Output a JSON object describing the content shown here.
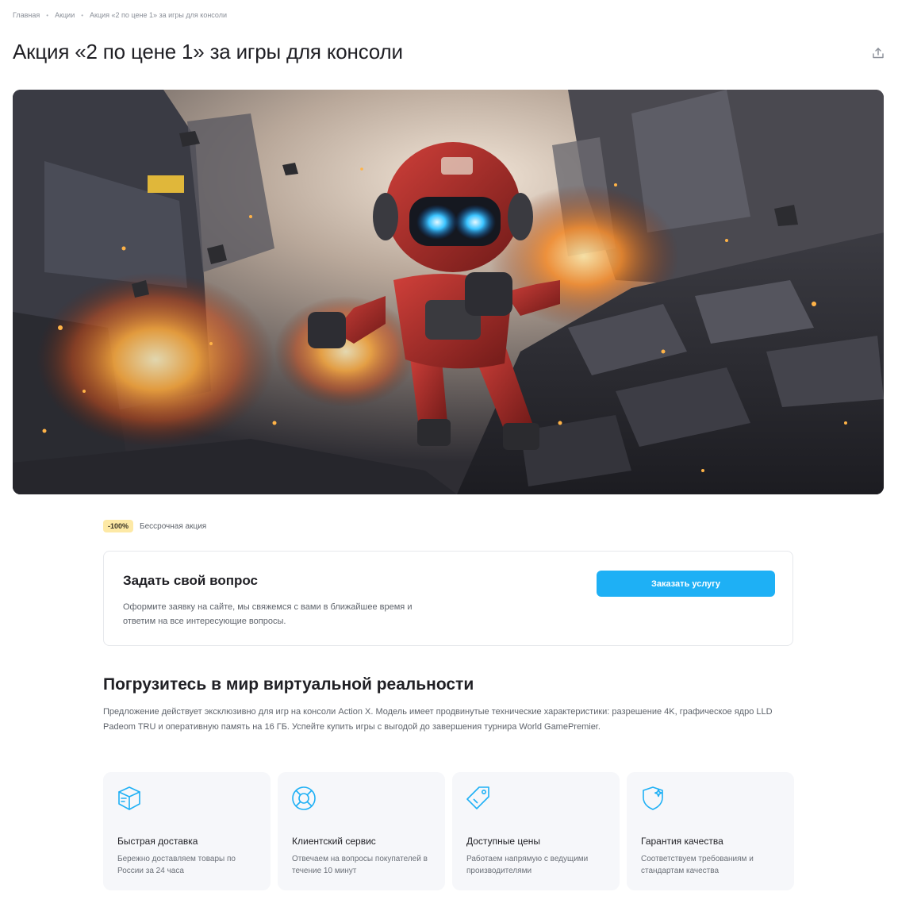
{
  "breadcrumb": {
    "items": [
      "Главная",
      "Акции",
      "Акция «2 по цене 1» за игры для консоли"
    ]
  },
  "page": {
    "title": "Акция «2 по цене 1» за игры для консоли",
    "share_icon": "share-upload-icon"
  },
  "hero": {
    "alt": "Red robot running through exploding city ruins"
  },
  "promo": {
    "discount": "-100%",
    "type": "Бессрочная акция"
  },
  "question": {
    "title": "Задать свой вопрос",
    "text": "Оформите заявку на сайте, мы свяжемся с вами в ближайшее время и ответим на все интересующие вопросы.",
    "button_label": "Заказать услугу"
  },
  "section": {
    "title": "Погрузитесь в мир виртуальной реальности",
    "text": "Предложение действует эксклюзивно для игр на консоли Action X. Модель имеет продвинутые технические характеристики: разрешение 4K, графическое ядро LLD Padeom TRU и оперативную память на 16 ГБ. Успейте купить игры с выгодой до завершения турнира World GamePremier."
  },
  "features": [
    {
      "icon": "box-icon",
      "title": "Быстрая доставка",
      "text": "Бережно доставляем товары по России за 24 часа"
    },
    {
      "icon": "lifebuoy-icon",
      "title": "Клиентский сервис",
      "text": "Отвечаем на вопросы покупателей в течение 10 минут"
    },
    {
      "icon": "price-tag-icon",
      "title": "Доступные цены",
      "text": "Работаем напрямую с ведущими производителями"
    },
    {
      "icon": "shield-star-icon",
      "title": "Гарантия качества",
      "text": "Соответствуем требованиям и стандартам качества"
    }
  ],
  "colors": {
    "accent": "#1eb0f5",
    "badge": "#fde9a6",
    "card_bg": "#f6f7fa",
    "icon": "#1eb0f5"
  }
}
